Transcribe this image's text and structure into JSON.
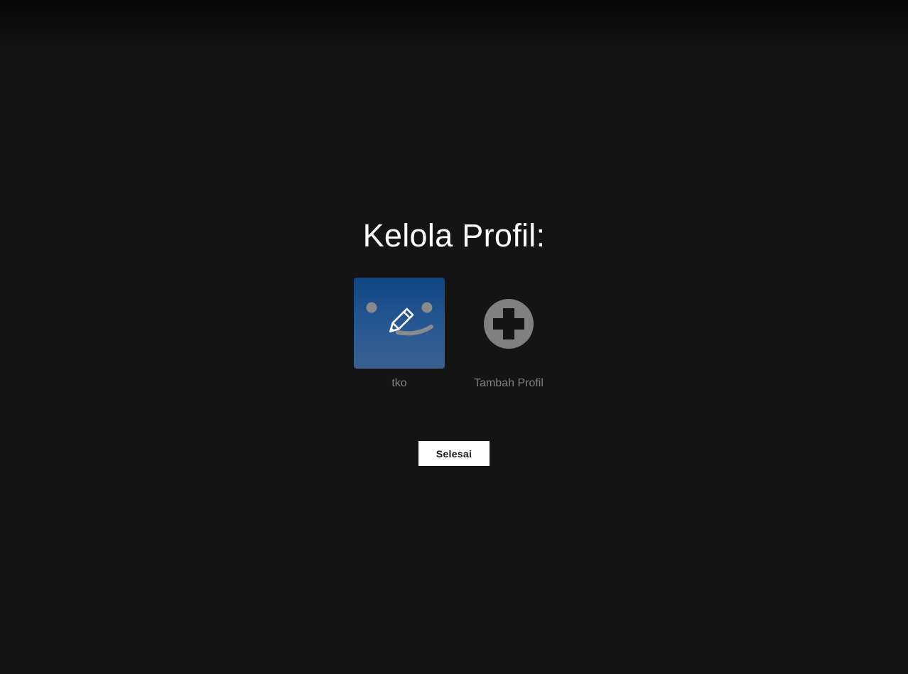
{
  "page": {
    "title": "Kelola Profil:"
  },
  "profiles": [
    {
      "name": "tko",
      "avatar": "smiley-avatar",
      "overlay_icon": "pencil-icon",
      "color": "#0f4584"
    }
  ],
  "add_profile": {
    "label": "Tambah Profil",
    "icon": "plus-circle-icon"
  },
  "actions": {
    "done_label": "Selesai"
  },
  "colors": {
    "background": "#141414",
    "text_primary": "#ffffff",
    "text_muted": "#808080",
    "button_bg": "#ffffff"
  }
}
